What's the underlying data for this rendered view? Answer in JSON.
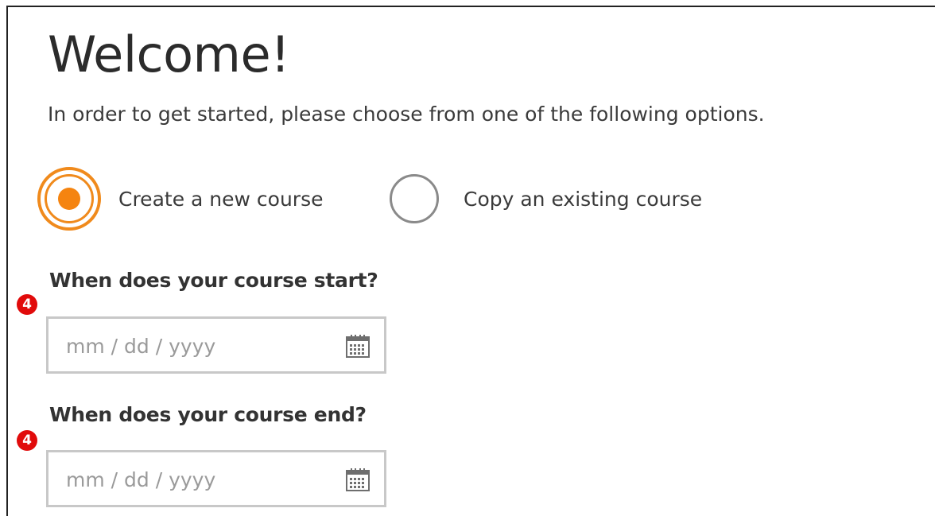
{
  "page": {
    "title": "Welcome!",
    "subtitle": "In order to get started, please choose from one of the following options."
  },
  "options": {
    "create_label": "Create a new course",
    "copy_label": "Copy an existing course",
    "selected": "create"
  },
  "start_date": {
    "question": "When does your course start?",
    "badge": "4",
    "placeholder": "mm / dd / yyyy",
    "icon": "calendar-icon"
  },
  "end_date": {
    "question": "When does your course end?",
    "badge": "4",
    "placeholder": "mm / dd / yyyy",
    "icon": "calendar-icon"
  },
  "colors": {
    "accent": "#f58410",
    "badge": "#e10b0b",
    "field_border": "#c8c8c8",
    "placeholder": "#9a9a9a"
  }
}
